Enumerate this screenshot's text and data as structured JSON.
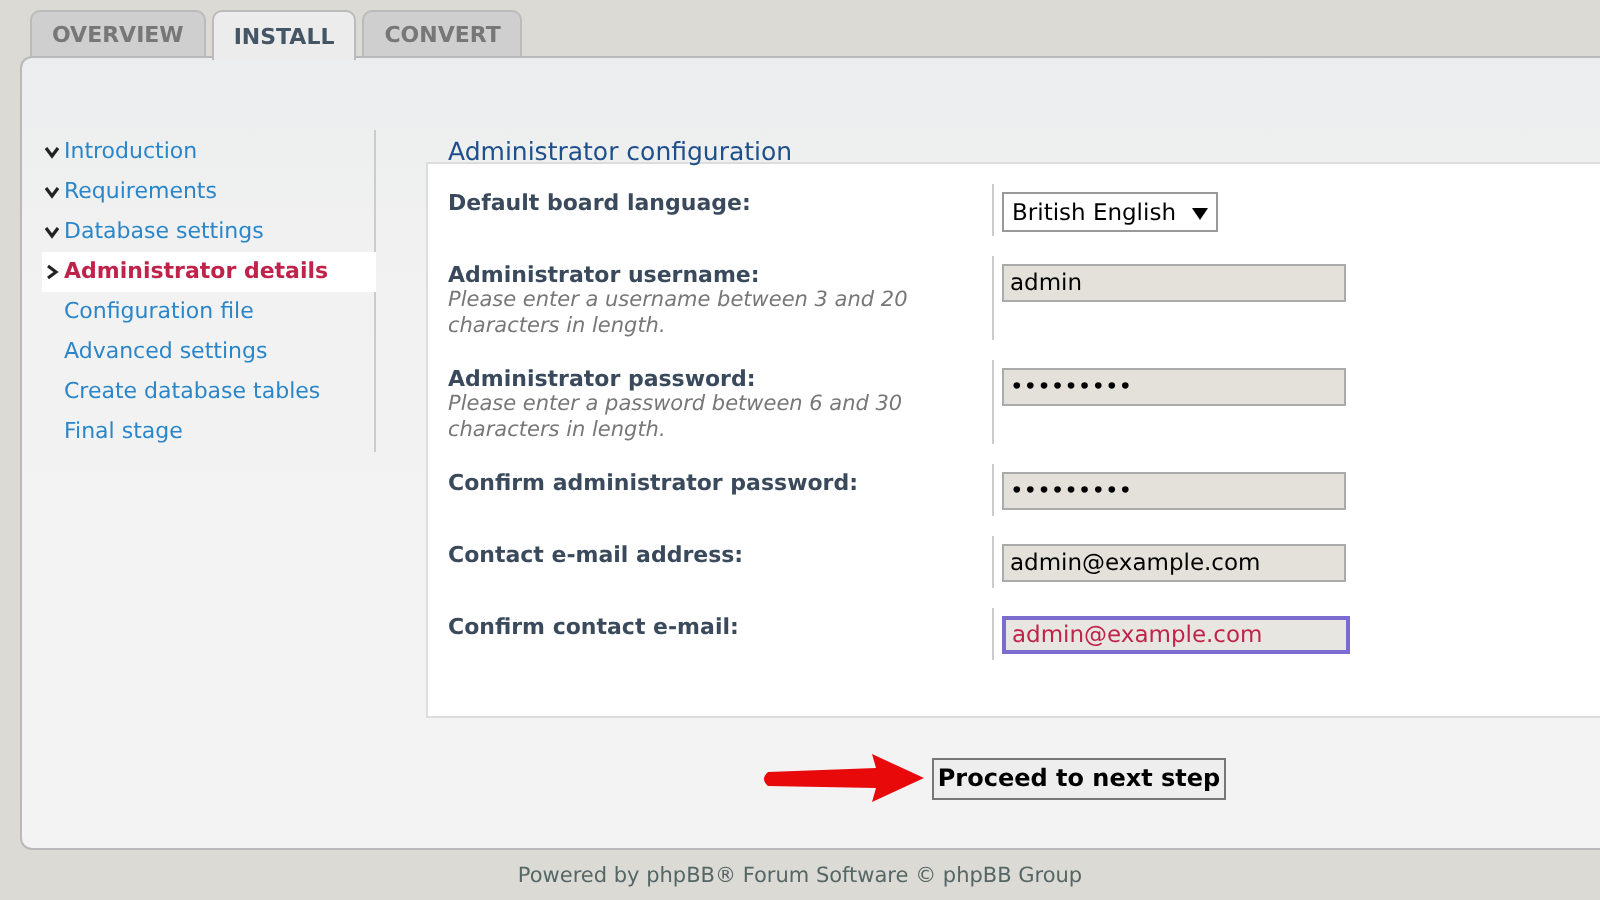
{
  "tabs": [
    {
      "label": "OVERVIEW",
      "selected": false
    },
    {
      "label": "INSTALL",
      "selected": true
    },
    {
      "label": "CONVERT",
      "selected": false
    }
  ],
  "steps": [
    {
      "label": "Introduction",
      "done": true,
      "selected": false
    },
    {
      "label": "Requirements",
      "done": true,
      "selected": false
    },
    {
      "label": "Database settings",
      "done": true,
      "selected": false
    },
    {
      "label": "Administrator details",
      "done": false,
      "selected": true
    },
    {
      "label": "Configuration file",
      "done": false,
      "selected": false
    },
    {
      "label": "Advanced settings",
      "done": false,
      "selected": false
    },
    {
      "label": "Create database tables",
      "done": false,
      "selected": false
    },
    {
      "label": "Final stage",
      "done": false,
      "selected": false
    }
  ],
  "form": {
    "heading": "Administrator configuration",
    "fields": [
      {
        "kind": "select",
        "label": "Default board language:",
        "value": "British English"
      },
      {
        "kind": "text",
        "label": "Administrator username:",
        "hint": "Please enter a username between 3 and 20 characters in length.",
        "value": "admin"
      },
      {
        "kind": "password",
        "label": "Administrator password:",
        "hint": "Please enter a password between 6 and 30 characters in length.",
        "value": "•••••••••"
      },
      {
        "kind": "password",
        "label": "Confirm administrator password:",
        "value": "•••••••••"
      },
      {
        "kind": "text",
        "label": "Contact e-mail address:",
        "value": "admin@example.com"
      },
      {
        "kind": "text",
        "label": "Confirm contact e-mail:",
        "value": "admin@example.com",
        "focused": true
      }
    ]
  },
  "submit": "Proceed to next step",
  "footer": "Powered by phpBB® Forum Software © phpBB Group"
}
